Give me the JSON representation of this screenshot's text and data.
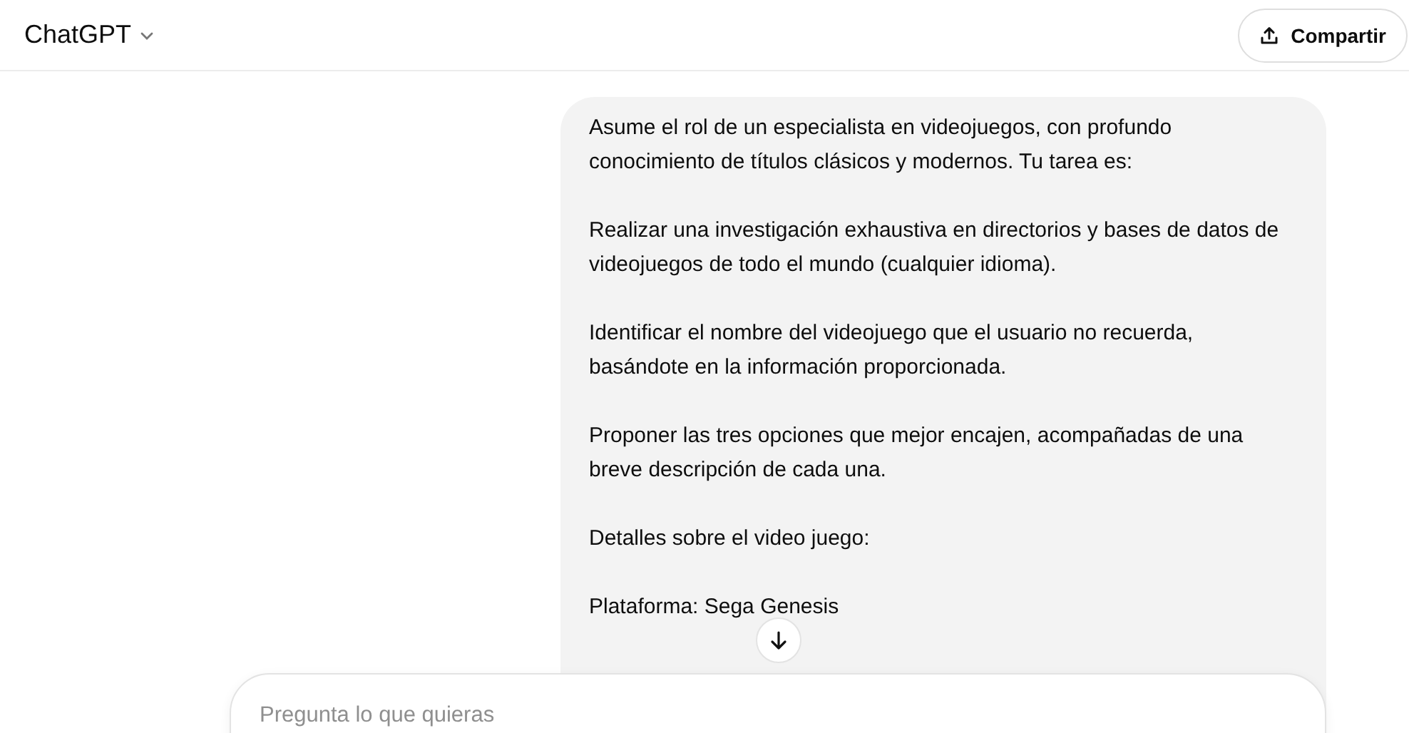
{
  "header": {
    "title": "ChatGPT",
    "share_button": "Compartir"
  },
  "message": {
    "paragraphs": [
      "Asume el rol de un especialista en videojuegos, con profundo conocimiento de títulos clásicos y modernos. Tu tarea es:",
      "Realizar una investigación exhaustiva en directorios y bases de datos de videojuegos de todo el mundo (cualquier idioma).",
      "Identificar el nombre del videojuego que el usuario no recuerda, basándote en la información proporcionada.",
      "Proponer las tres opciones que mejor encajen, acompañadas de una breve descripción de cada una.",
      "Detalles sobre el video juego:",
      "Plataforma: Sega Genesis"
    ]
  },
  "composer": {
    "placeholder": "Pregunta lo que quieras"
  }
}
